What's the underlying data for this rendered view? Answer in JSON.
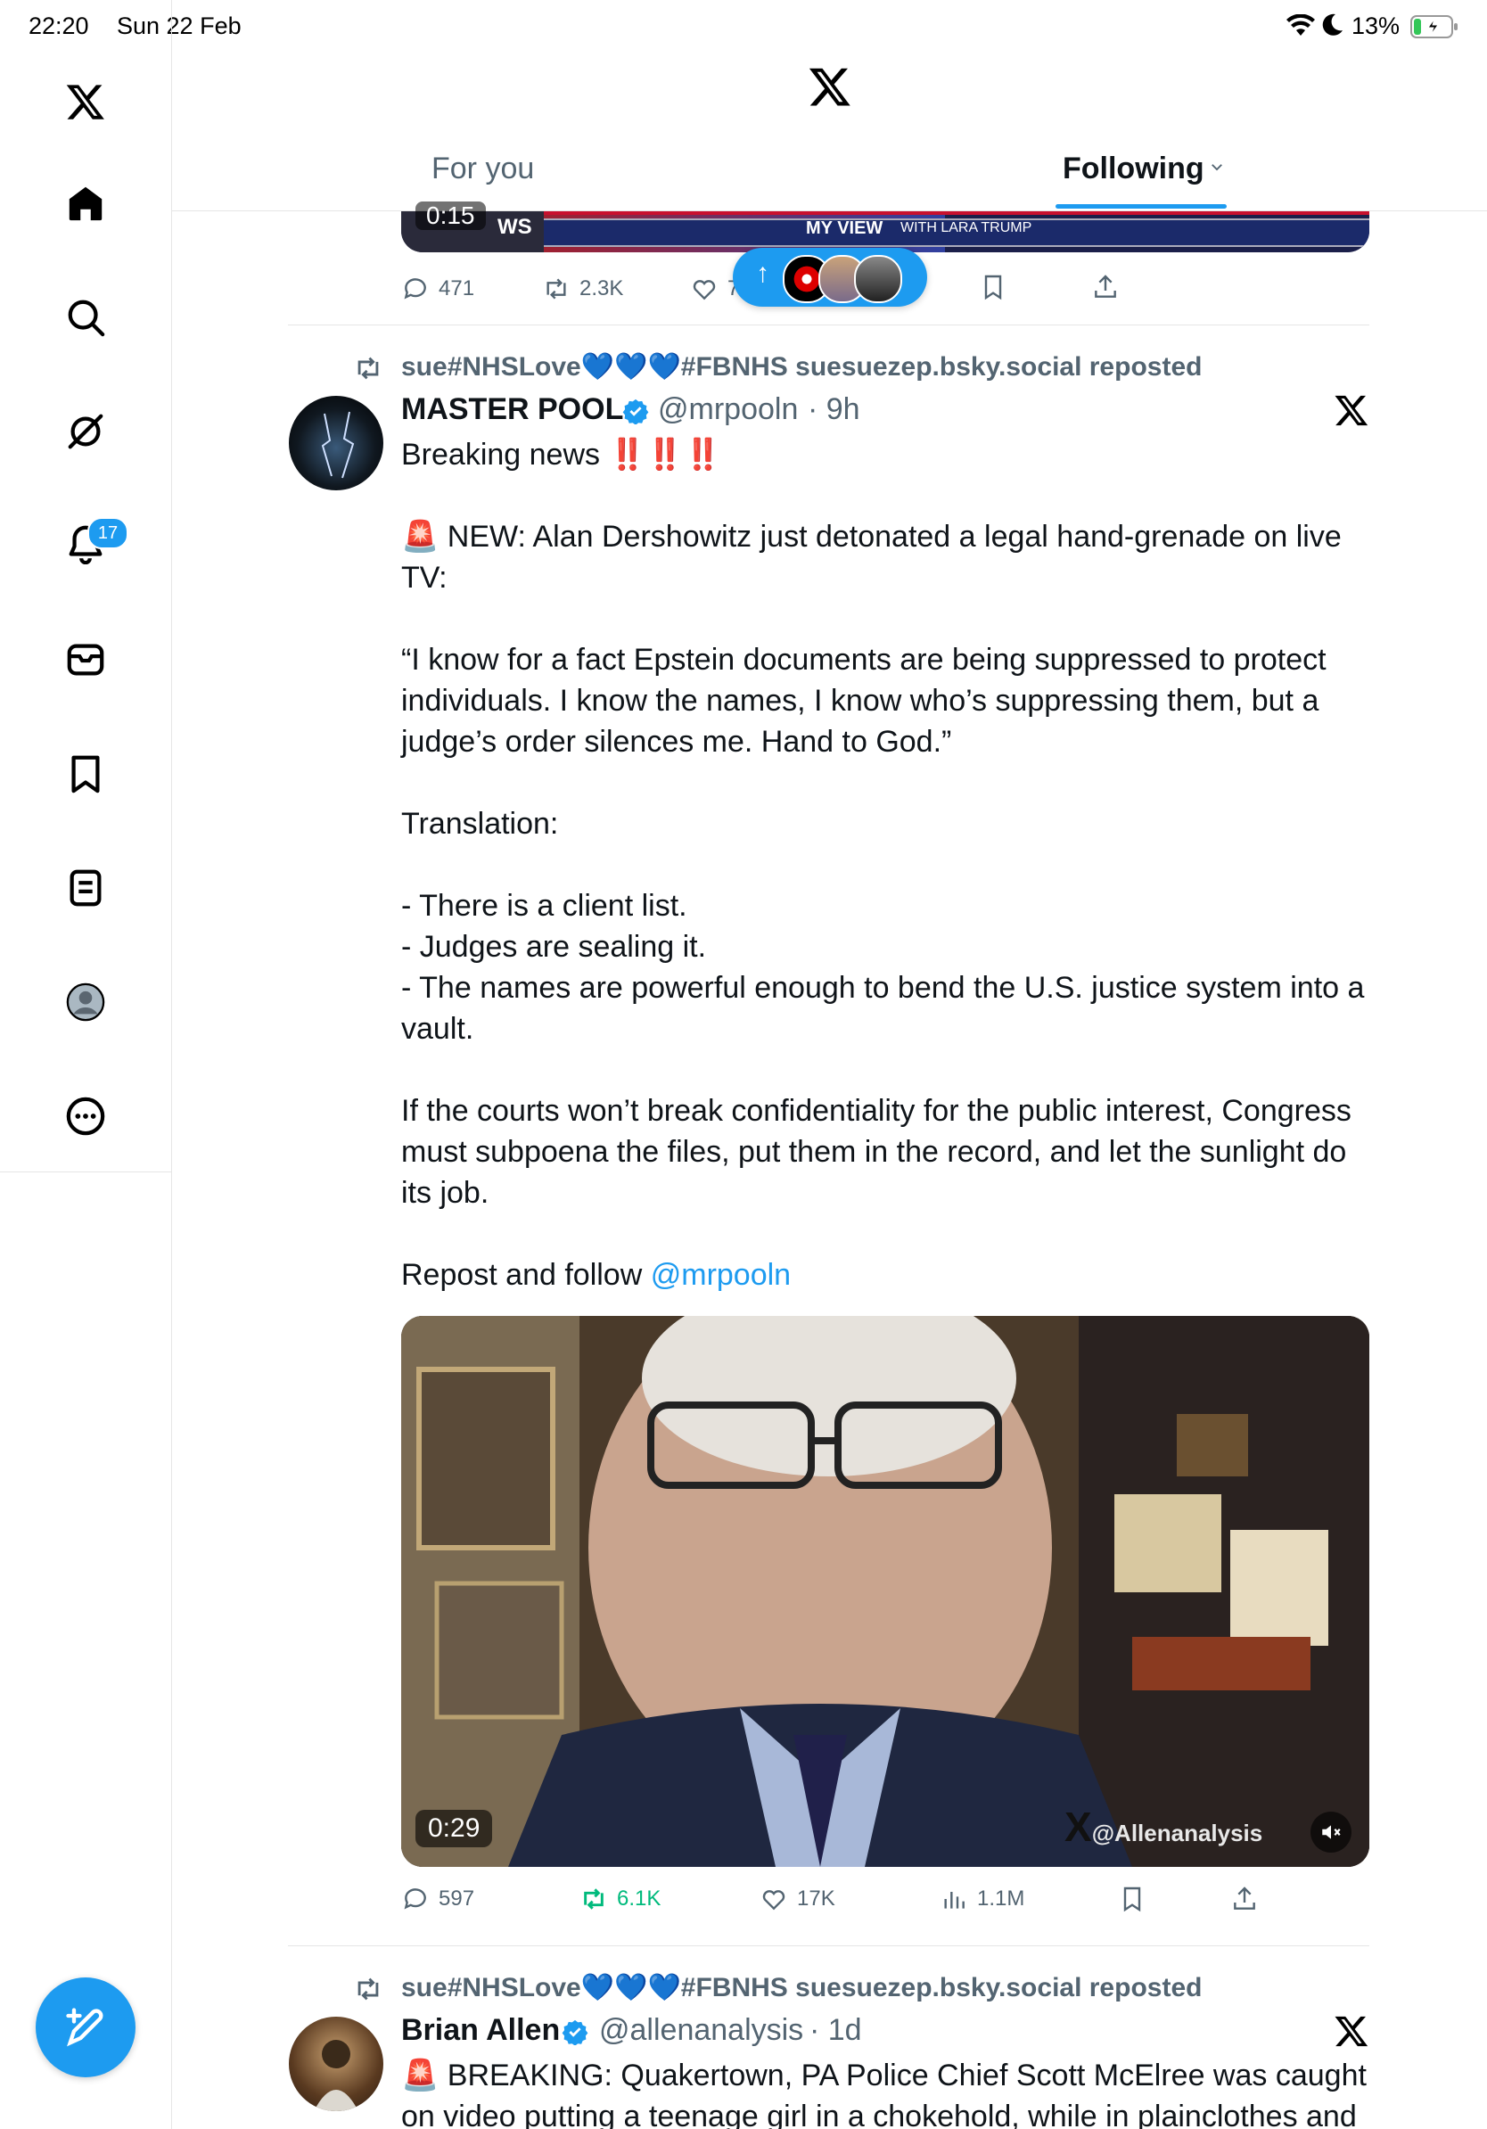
{
  "status_bar": {
    "time": "22:20",
    "date": "Sun 22 Feb",
    "battery": "13%"
  },
  "sidebar": {
    "notifications_badge": "17",
    "items": [
      "home-icon",
      "search-icon",
      "grok-icon",
      "notifications-icon",
      "messages-icon",
      "bookmarks-icon",
      "lists-icon",
      "profile-icon",
      "more-icon"
    ]
  },
  "header": {
    "logo": "x-logo"
  },
  "tabs": [
    {
      "label": "For you",
      "active": false
    },
    {
      "label": "Following",
      "active": true
    }
  ],
  "top_tweet": {
    "video_duration": "0:15",
    "banner_text": "MY VIEW",
    "banner_sub": "WITH LARA TRUMP",
    "banner_left": "WS",
    "actions": {
      "replies": "471",
      "reposts": "2.3K",
      "likes": "7"
    }
  },
  "new_posts_pill": {
    "arrow": "↑"
  },
  "tweet1": {
    "reposted_by": "sue#NHSLove💙💙💙#FBNHS suesuezep.bsky.social reposted",
    "name": "MASTER POOL",
    "handle": "@mrpooln",
    "time": "· 9h",
    "body": "Breaking news ‼️‼️‼️\n\n🚨 NEW: Alan Dershowitz just detonated a legal hand-grenade on live TV:\n\n“I know for a fact Epstein documents are being suppressed to protect individuals. I know the names, I know who’s suppressing them, but a judge’s order silences me. Hand to God.”\n\nTranslation:\n\n- There is a client list.\n- Judges are sealing it.\n- The names are powerful enough to bend the U.S. justice system into a vault.\n\nIf the courts won’t break confidentiality for the public interest, Congress must subpoena the files, put them in the record, and let the sunlight do its job.\n\nRepost and follow ",
    "mention": "@mrpooln",
    "video_duration": "0:29",
    "watermark": "@Allenanalysis",
    "actions": {
      "replies": "597",
      "reposts": "6.1K",
      "likes": "17K",
      "views": "1.1M"
    }
  },
  "tweet2": {
    "reposted_by": "sue#NHSLove💙💙💙#FBNHS suesuezep.bsky.social reposted",
    "name": "Brian Allen",
    "handle": "@allenanalysis",
    "time": "· 1d",
    "body": "🚨 BREAKING: Quakertown, PA Police Chief Scott McElree was caught\non video putting a teenage girl in a chokehold, while in plainclothes and"
  },
  "colors": {
    "accent": "#1d9bf0",
    "repost_green": "#00ba7c",
    "muted": "#536471"
  }
}
